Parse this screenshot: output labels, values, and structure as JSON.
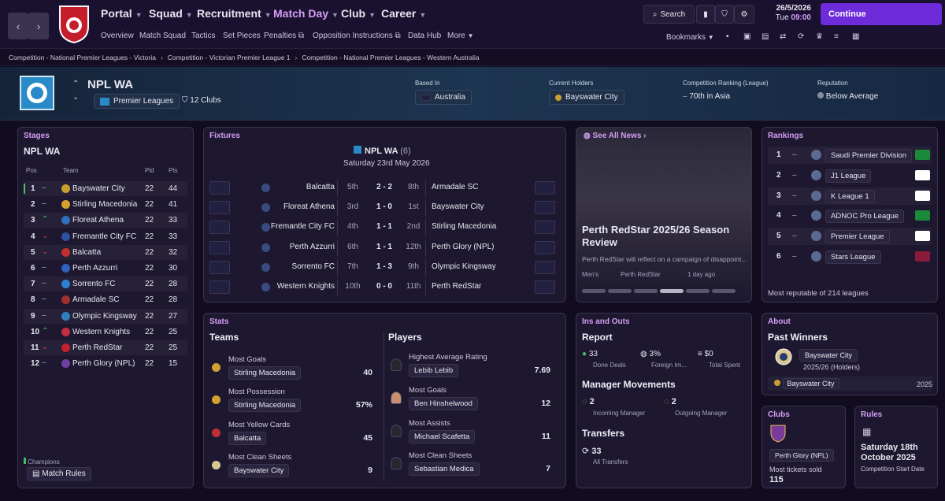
{
  "nav": {
    "back": "‹",
    "forward": "›",
    "club_logo_text": "ADELAIDE UNITED F.C.",
    "menus": [
      {
        "label": "Portal"
      },
      {
        "label": "Squad"
      },
      {
        "label": "Recruitment"
      },
      {
        "label": "Match Day"
      },
      {
        "label": "Club"
      },
      {
        "label": "Career"
      }
    ],
    "submenu": [
      "Overview",
      "Match Squad",
      "Tactics",
      "Set Pieces",
      "Penalties",
      "Opposition Instructions",
      "Data Hub",
      "More"
    ],
    "search_label": "Search",
    "date": "26/5/2026",
    "day": "Tue",
    "time": "09:00",
    "continue_label": "Continue",
    "bookmarks_label": "Bookmarks"
  },
  "breadcrumbs": [
    "Competition - National Premier Leagues - Victoria",
    "Competition - Victorian Premier League 1",
    "Competition - National Premier Leagues - Western Australia"
  ],
  "header": {
    "name": "NPL WA",
    "type": "Premier Leagues",
    "clubs": "12 Clubs",
    "based_in_label": "Based In",
    "based_in": "Australia",
    "holders_label": "Current Holders",
    "holders": "Bayswater City",
    "ranking_label": "Competition Ranking (League)",
    "ranking": "70th in Asia",
    "reputation_label": "Reputation",
    "reputation": "Below Average"
  },
  "stages": {
    "title": "Stages",
    "league": "NPL WA",
    "cols": {
      "pos": "Pos",
      "team": "Team",
      "pld": "Pld",
      "pts": "Pts"
    },
    "rows": [
      {
        "pos": "1",
        "move": "–",
        "team": "Bayswater City",
        "pld": "22",
        "pts": "44",
        "color": "#c8a030",
        "dir": "same"
      },
      {
        "pos": "2",
        "move": "–",
        "team": "Stirling Macedonia",
        "pld": "22",
        "pts": "41",
        "color": "#d4a030",
        "dir": "same"
      },
      {
        "pos": "3",
        "move": "^",
        "team": "Floreat Athena",
        "pld": "22",
        "pts": "33",
        "color": "#3070c0",
        "dir": "up"
      },
      {
        "pos": "4",
        "move": "v",
        "team": "Fremantle City FC",
        "pld": "22",
        "pts": "33",
        "color": "#3050a0",
        "dir": "down"
      },
      {
        "pos": "5",
        "move": "v",
        "team": "Balcatta",
        "pld": "22",
        "pts": "32",
        "color": "#c03030",
        "dir": "down"
      },
      {
        "pos": "6",
        "move": "–",
        "team": "Perth Azzurri",
        "pld": "22",
        "pts": "30",
        "color": "#3060c0",
        "dir": "same"
      },
      {
        "pos": "7",
        "move": "–",
        "team": "Sorrento FC",
        "pld": "22",
        "pts": "28",
        "color": "#3080d0",
        "dir": "same"
      },
      {
        "pos": "8",
        "move": "–",
        "team": "Armadale SC",
        "pld": "22",
        "pts": "28",
        "color": "#a03030",
        "dir": "same"
      },
      {
        "pos": "9",
        "move": "–",
        "team": "Olympic Kingsway",
        "pld": "22",
        "pts": "27",
        "color": "#3080c0",
        "dir": "same"
      },
      {
        "pos": "10",
        "move": "^",
        "team": "Western Knights",
        "pld": "22",
        "pts": "25",
        "color": "#c03040",
        "dir": "up"
      },
      {
        "pos": "11",
        "move": "v",
        "team": "Perth RedStar",
        "pld": "22",
        "pts": "25",
        "color": "#c02030",
        "dir": "down"
      },
      {
        "pos": "12",
        "move": "–",
        "team": "Perth Glory (NPL)",
        "pld": "22",
        "pts": "15",
        "color": "#7040a0",
        "dir": "same"
      }
    ],
    "legend": "Champions",
    "rules_button": "Match Rules"
  },
  "fixtures": {
    "title": "Fixtures",
    "league": "NPL WA",
    "round": "(6)",
    "date": "Saturday 23rd May 2026",
    "rows": [
      {
        "home": "Balcatta",
        "hpos": "5th",
        "score": "2 - 2",
        "apos": "8th",
        "away": "Armadale SC"
      },
      {
        "home": "Floreat Athena",
        "hpos": "3rd",
        "score": "1 - 0",
        "apos": "1st",
        "away": "Bayswater City"
      },
      {
        "home": "Fremantle City FC",
        "hpos": "4th",
        "score": "1 - 1",
        "apos": "2nd",
        "away": "Stirling Macedonia"
      },
      {
        "home": "Perth Azzurri",
        "hpos": "6th",
        "score": "1 - 1",
        "apos": "12th",
        "away": "Perth Glory (NPL)"
      },
      {
        "home": "Sorrento FC",
        "hpos": "7th",
        "score": "1 - 3",
        "apos": "9th",
        "away": "Olympic Kingsway"
      },
      {
        "home": "Western Knights",
        "hpos": "10th",
        "score": "0 - 0",
        "apos": "11th",
        "away": "Perth RedStar"
      }
    ]
  },
  "news": {
    "see_all": "See All News",
    "headline": "Perth RedStar 2025/26 Season Review",
    "snippet": "Perth RedStar will reflect on a campaign of disappoint...",
    "tags": [
      "Men's",
      "Perth RedStar",
      "1 day ago"
    ]
  },
  "rankings": {
    "title": "Rankings",
    "rows": [
      {
        "pos": "1",
        "move": "–",
        "name": "Saudi Premier Division",
        "flag": "SA"
      },
      {
        "pos": "2",
        "move": "–",
        "name": "J1 League",
        "flag": "JP"
      },
      {
        "pos": "3",
        "move": "–",
        "name": "K League 1",
        "flag": "KR"
      },
      {
        "pos": "4",
        "move": "–",
        "name": "ADNOC Pro League",
        "flag": "AE"
      },
      {
        "pos": "5",
        "move": "–",
        "name": "Premier League",
        "flag": "IR"
      },
      {
        "pos": "6",
        "move": "–",
        "name": "Stars League",
        "flag": "QA"
      }
    ],
    "footer": "Most reputable of 214 leagues"
  },
  "stats": {
    "title": "Stats",
    "teams_label": "Teams",
    "players_label": "Players",
    "teams": [
      {
        "label": "Most Goals",
        "name": "Stirling Macedonia",
        "value": "40"
      },
      {
        "label": "Most Possession",
        "name": "Stirling Macedonia",
        "value": "57%"
      },
      {
        "label": "Most Yellow Cards",
        "name": "Balcatta",
        "value": "45"
      },
      {
        "label": "Most Clean Sheets",
        "name": "Bayswater City",
        "value": "9"
      }
    ],
    "players": [
      {
        "label": "Highest Average Rating",
        "name": "Lebib Lebib",
        "value": "7.69"
      },
      {
        "label": "Most Goals",
        "name": "Ben Hinshelwood",
        "value": "12"
      },
      {
        "label": "Most Assists",
        "name": "Michael Scafetta",
        "value": "11"
      },
      {
        "label": "Most Clean Sheets",
        "name": "Sebastian Medica",
        "value": "7"
      }
    ]
  },
  "ins": {
    "title": "Ins and Outs",
    "report_label": "Report",
    "done": "33",
    "done_label": "Done Deals",
    "foreign": "3%",
    "foreign_label": "Foreign Im...",
    "spent": "$0",
    "spent_label": "Total Spent",
    "mgr_label": "Manager Movements",
    "incoming": "2",
    "incoming_label": "Incoming Manager",
    "outgoing": "2",
    "outgoing_label": "Outgoing Manager",
    "transfers_label": "Transfers",
    "transfers": "33",
    "transfers_sub": "All Transfers"
  },
  "about": {
    "title": "About",
    "past_label": "Past Winners",
    "winner": "Bayswater City",
    "season": "2025/26 (Holders)",
    "row_name": "Bayswater City",
    "row_year": "2025"
  },
  "clubs": {
    "title": "Clubs",
    "club": "Perth Glory (NPL)",
    "tickets_label": "Most tickets sold",
    "tickets": "115"
  },
  "rules": {
    "title": "Rules",
    "date": "Saturday 18th October 2025",
    "sub": "Competition Start Date"
  },
  "colors": {
    "accent": "#d49ff5",
    "continue": "#6d2bd9"
  }
}
